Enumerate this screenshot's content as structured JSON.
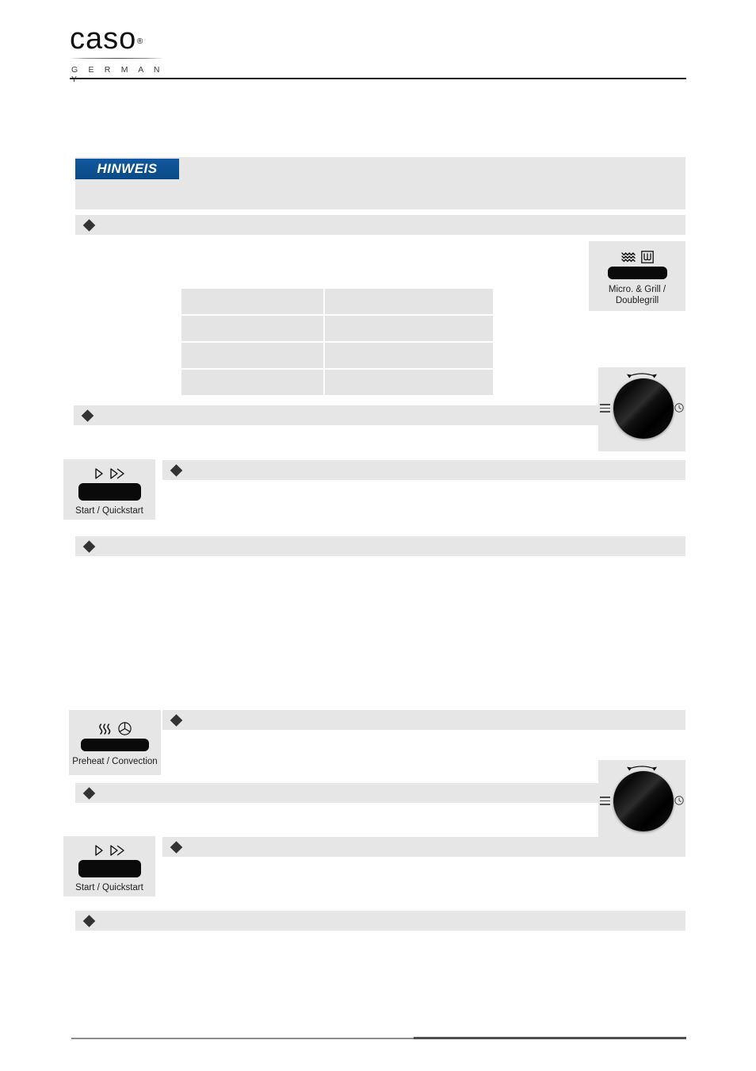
{
  "header": {
    "logo_word": "caso",
    "logo_reg": "®",
    "logo_sub": "G E R M A N Y"
  },
  "notice": {
    "tag_label": "HINWEIS",
    "body_text": ""
  },
  "bullets": [
    {
      "id": "bullet-1",
      "text": ""
    },
    {
      "id": "bullet-2",
      "text": ""
    },
    {
      "id": "bullet-3",
      "text": ""
    },
    {
      "id": "bullet-4",
      "text": ""
    },
    {
      "id": "bullet-5",
      "text": ""
    },
    {
      "id": "bullet-6",
      "text": ""
    },
    {
      "id": "bullet-7",
      "text": ""
    }
  ],
  "table": {
    "rows": [
      {
        "col_a": "",
        "col_b": ""
      },
      {
        "col_a": "",
        "col_b": ""
      },
      {
        "col_a": "",
        "col_b": ""
      },
      {
        "col_a": "",
        "col_b": ""
      }
    ]
  },
  "keys": {
    "micro_grill": {
      "label": "Micro. & Grill /\nDoublegrill",
      "label_line1": "Micro. & Grill /",
      "label_line2": "Doublegrill",
      "icons": [
        "microwave-wave-icon",
        "grill-icon"
      ]
    },
    "start_quickstart_top": {
      "label": "Start / Quickstart",
      "icons": [
        "play-icon",
        "fast-forward-icon"
      ]
    },
    "preheat_convection": {
      "label": "Preheat / Convection",
      "icons": [
        "heat-waves-icon",
        "fan-icon"
      ]
    },
    "start_quickstart_bottom": {
      "label": "Start / Quickstart",
      "icons": [
        "play-icon",
        "fast-forward-icon"
      ]
    }
  },
  "knobs": {
    "top": {
      "name": "rotary-knob",
      "left_icon": "menu-icon",
      "right_icon": "clock-icon",
      "top_icon": "bidirectional-arrow-icon"
    },
    "bottom": {
      "name": "rotary-knob",
      "left_icon": "menu-icon",
      "right_icon": "clock-icon",
      "top_icon": "bidirectional-arrow-icon"
    }
  },
  "colors": {
    "notice_tag_bg": "#0d4f8b",
    "bar_bg": "#e6e6e6",
    "key_plate": "#0a0a0a",
    "diamond": "#333333",
    "rule_dark": "#222222"
  }
}
